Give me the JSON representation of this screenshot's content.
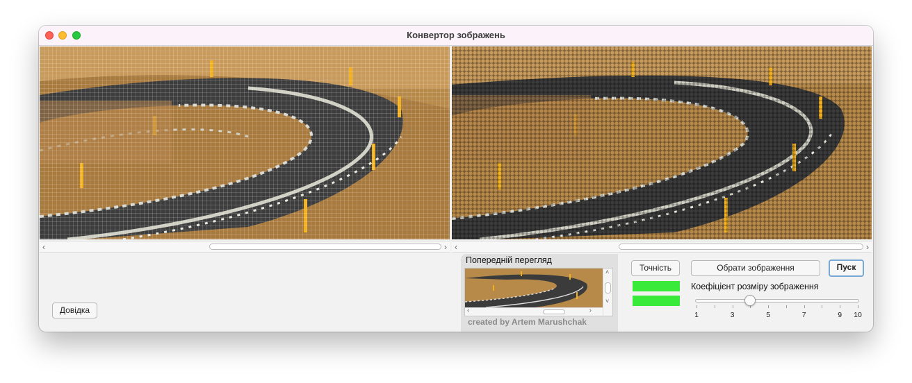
{
  "window": {
    "title": "Конвертор зображень"
  },
  "panes": {
    "left_alt": "pixel-grid image of a curved road",
    "right_alt": "hexagon-grid image of a curved road"
  },
  "preview": {
    "label": "Попередній перегляд"
  },
  "controls": {
    "accuracy_label": "Точність",
    "choose_image_label": "Обрати зображення",
    "start_label": "Пуск",
    "help_label": "Довідка",
    "scale_label": "Коефіцієнт розміру зображення"
  },
  "slider": {
    "min": 1,
    "max": 10,
    "value": 4,
    "tick_labels": [
      "1",
      "3",
      "5",
      "7",
      "9",
      "10"
    ]
  },
  "credit": "created by Artem Marushchak",
  "colors": {
    "indicator": "#3aea3a",
    "default_button_border": "#79a8d6"
  },
  "icons": {
    "scroll_left": "‹",
    "scroll_right": "›",
    "scroll_up": "˄",
    "scroll_down": "˅"
  }
}
